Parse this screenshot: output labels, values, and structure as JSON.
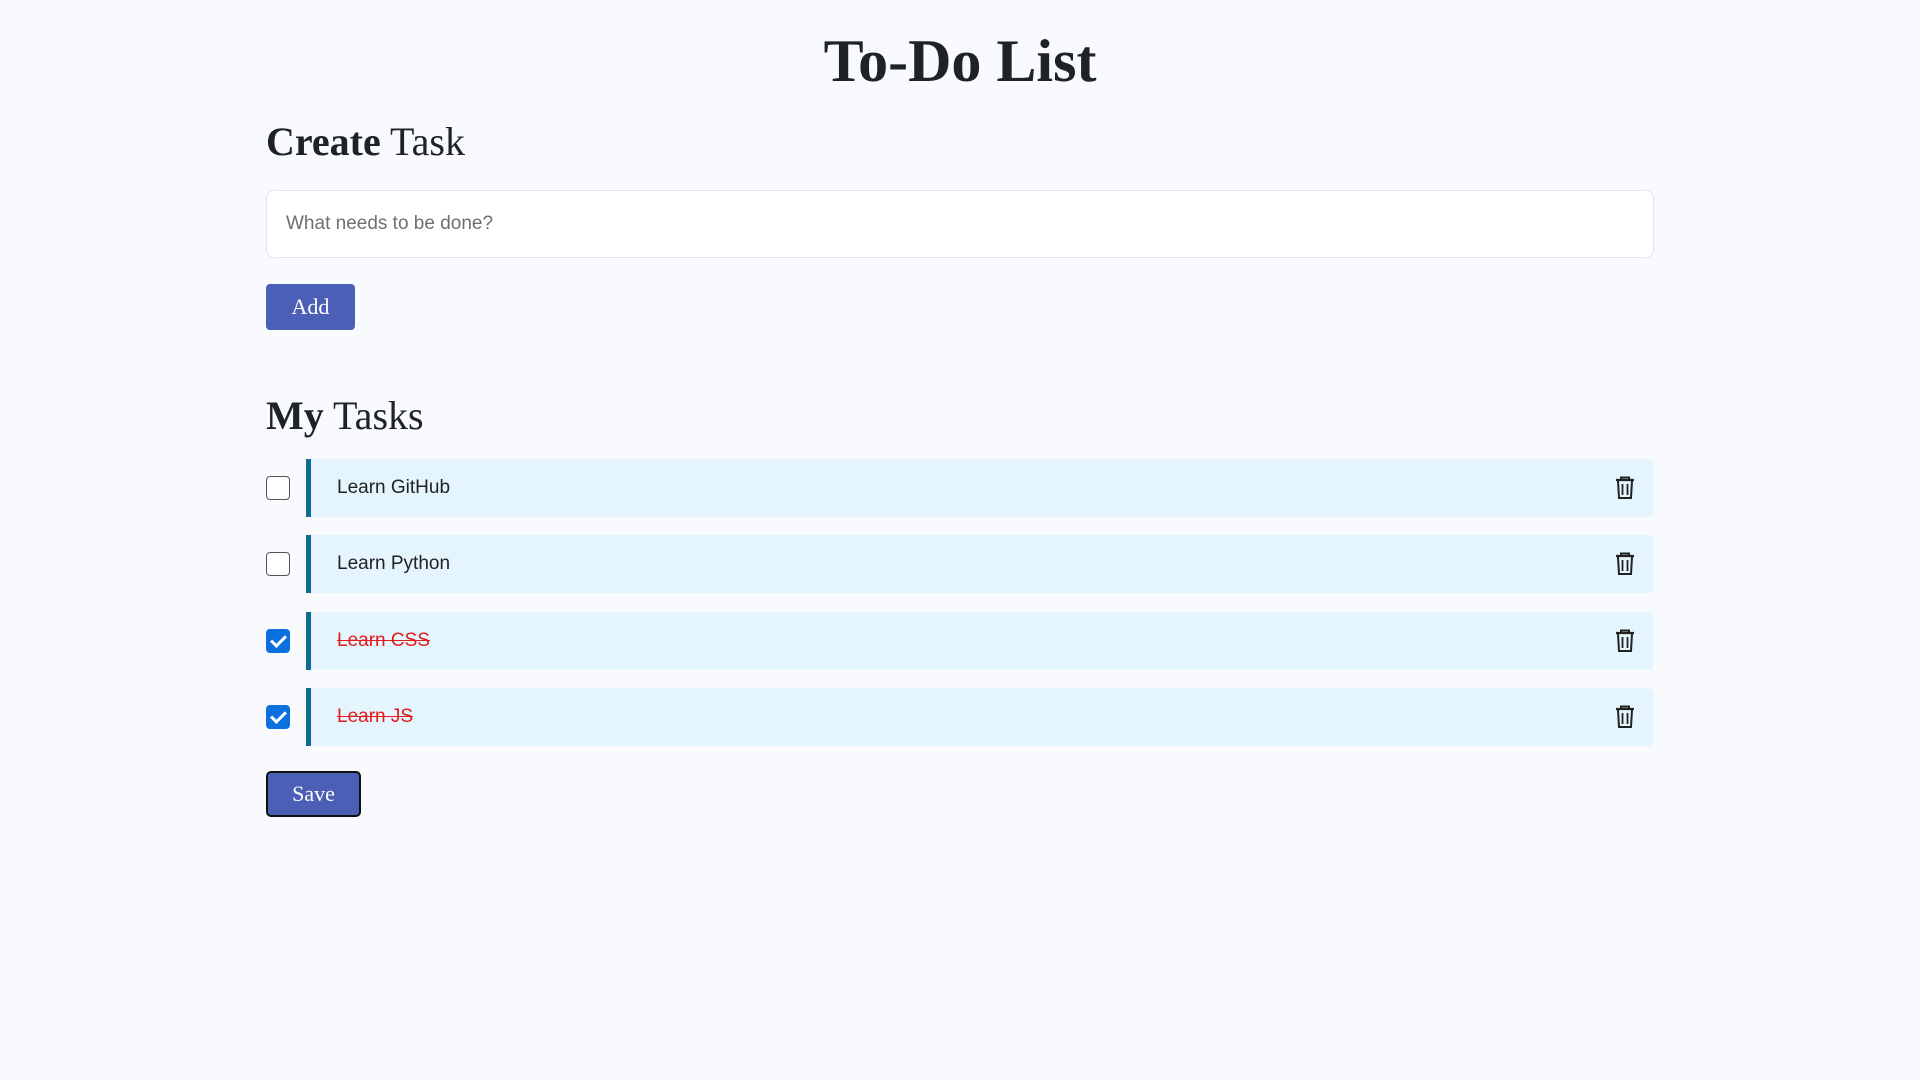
{
  "page": {
    "title": "To-Do List"
  },
  "create": {
    "heading_bold": "Create",
    "heading_rest": " Task",
    "placeholder": "What needs to be done?",
    "value": "",
    "add_label": "Add"
  },
  "tasks": {
    "heading_bold": "My",
    "heading_rest": " Tasks",
    "items": [
      {
        "label": "Learn GitHub",
        "done": false
      },
      {
        "label": "Learn Python",
        "done": false
      },
      {
        "label": "Learn CSS",
        "done": true
      },
      {
        "label": "Learn JS",
        "done": true
      }
    ],
    "save_label": "Save"
  },
  "icons": {
    "delete": "trash-icon",
    "check": "checkbox-icon"
  },
  "colors": {
    "accent": "#4a5fb5",
    "task_bg": "#e4f5fd",
    "task_border": "#0d6e8f",
    "done_text": "#e01b1b",
    "checkbox_checked": "#0b6fe0"
  }
}
